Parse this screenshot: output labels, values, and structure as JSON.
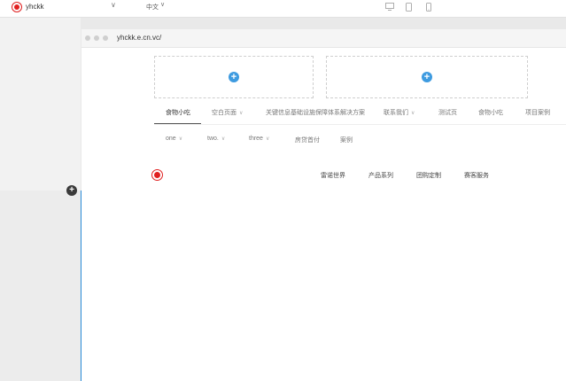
{
  "toolbar": {
    "site_name": "yhckk",
    "site_dropdown": "∨",
    "language": "中文",
    "language_dropdown": "∨"
  },
  "browser": {
    "url": "yhckk.e.cn.vc/"
  },
  "nav": {
    "items": [
      {
        "label": "食物小吃",
        "chevron": ""
      },
      {
        "label": "空白页面",
        "chevron": "∨"
      },
      {
        "label": "关键信息基础设施保障体系解决方案",
        "chevron": ""
      },
      {
        "label": "联系我们",
        "chevron": "∨"
      },
      {
        "label": "测试页",
        "chevron": ""
      },
      {
        "label": "食物小吃",
        "chevron": ""
      },
      {
        "label": "项目案例",
        "chevron": ""
      }
    ],
    "sub_items": [
      {
        "label": "one",
        "chevron": "∨"
      },
      {
        "label": "two.",
        "chevron": "∨"
      },
      {
        "label": "three",
        "chevron": "∨"
      },
      {
        "label": "房贷首付",
        "chevron": ""
      },
      {
        "label": "案例",
        "chevron": ""
      }
    ]
  },
  "footer_menu": {
    "items": [
      "雷诺世界",
      "产品系列",
      "团购定制",
      "赛客服务"
    ]
  },
  "colors": {
    "brand_red": "#e02020",
    "accent_blue": "#3e9be0",
    "selection_blue": "#2a8bd8"
  },
  "icons": {
    "add": "+"
  }
}
